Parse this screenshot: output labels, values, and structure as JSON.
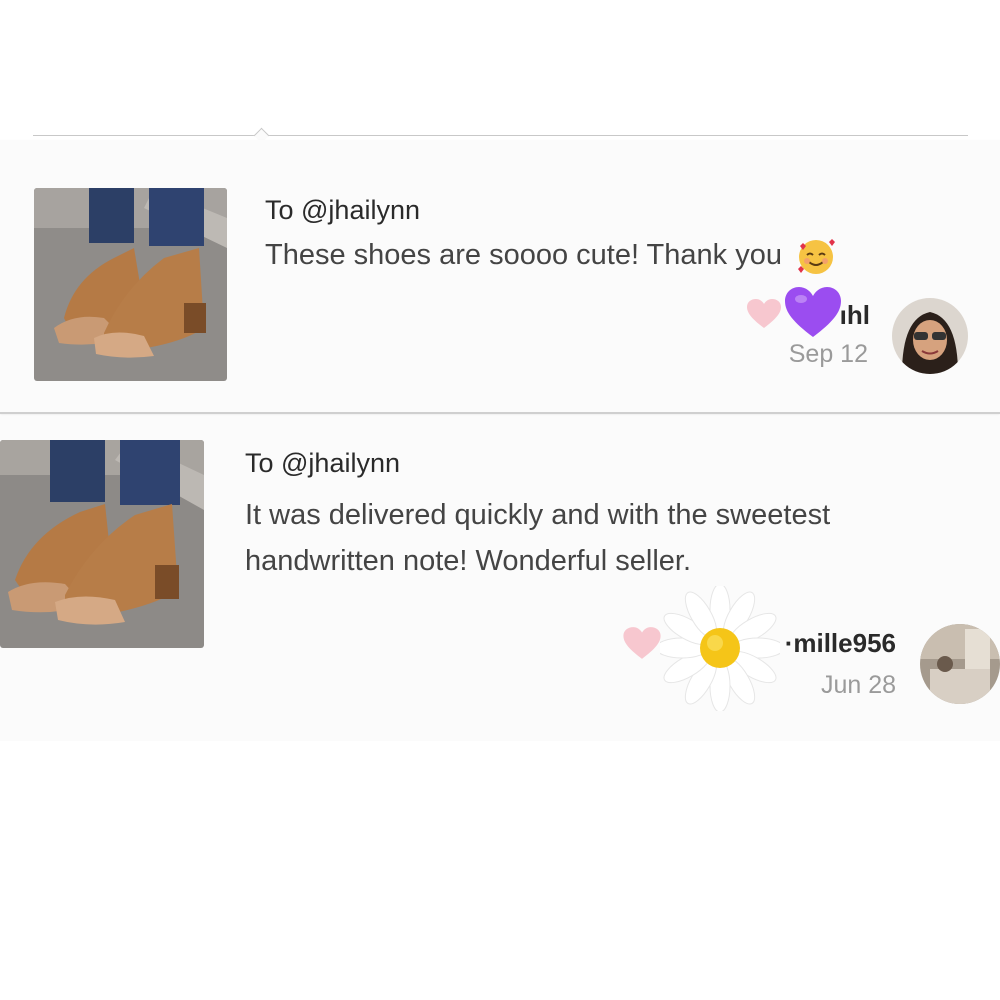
{
  "reviews": [
    {
      "to": "To @jhailynn",
      "message": "These shoes are soooo cute! Thank you",
      "emoji_icon": "smiling-face-with-hearts-icon",
      "username": "ıhl",
      "date": "Sep 12",
      "like_icon": "heart-icon",
      "sticker_icon": "purple-heart-icon"
    },
    {
      "to": "To @jhailynn",
      "message_line1": "It was delivered quickly and with the sweetest",
      "message_line2": "handwritten note! Wonderful seller.",
      "username": "·mille956",
      "date": "Jun 28",
      "like_icon": "heart-icon",
      "sticker_icon": "daisy-icon"
    }
  ],
  "colors": {
    "heart": "#f7c7cf",
    "purple_heart": "#9b4df0",
    "text": "#3a3a3a",
    "muted": "#9a9a9a",
    "sandal": "#b57a45"
  }
}
